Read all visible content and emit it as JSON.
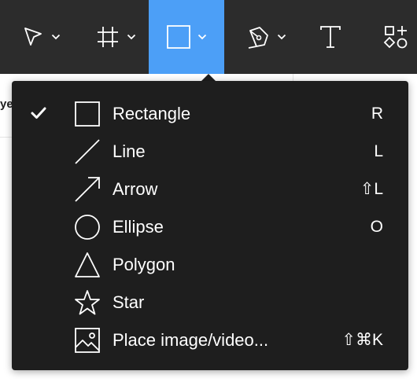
{
  "toolbar": {
    "tools": [
      {
        "name": "move",
        "icon": "cursor-icon",
        "has_menu": true
      },
      {
        "name": "frame",
        "icon": "frame-icon",
        "has_menu": true
      },
      {
        "name": "shape",
        "icon": "rectangle-icon",
        "has_menu": true,
        "active": true
      },
      {
        "name": "pen",
        "icon": "pen-icon",
        "has_menu": true
      },
      {
        "name": "text",
        "icon": "text-icon",
        "has_menu": false
      },
      {
        "name": "resources",
        "icon": "resources-icon",
        "has_menu": false
      }
    ],
    "active_color": "#4c9ff7",
    "background_color": "#2c2c2c"
  },
  "panel": {
    "fragment_text": "ye"
  },
  "shape_menu": {
    "background_color": "#1e1e1e",
    "items": [
      {
        "label": "Rectangle",
        "shortcut": "R",
        "icon": "rectangle-icon",
        "checked": true
      },
      {
        "label": "Line",
        "shortcut": "L",
        "icon": "line-icon",
        "checked": false
      },
      {
        "label": "Arrow",
        "shortcut": "⇧L",
        "icon": "arrow-icon",
        "checked": false
      },
      {
        "label": "Ellipse",
        "shortcut": "O",
        "icon": "ellipse-icon",
        "checked": false
      },
      {
        "label": "Polygon",
        "shortcut": "",
        "icon": "polygon-icon",
        "checked": false
      },
      {
        "label": "Star",
        "shortcut": "",
        "icon": "star-icon",
        "checked": false
      },
      {
        "label": "Place image/video...",
        "shortcut": "⇧⌘K",
        "icon": "image-icon",
        "checked": false
      }
    ]
  }
}
